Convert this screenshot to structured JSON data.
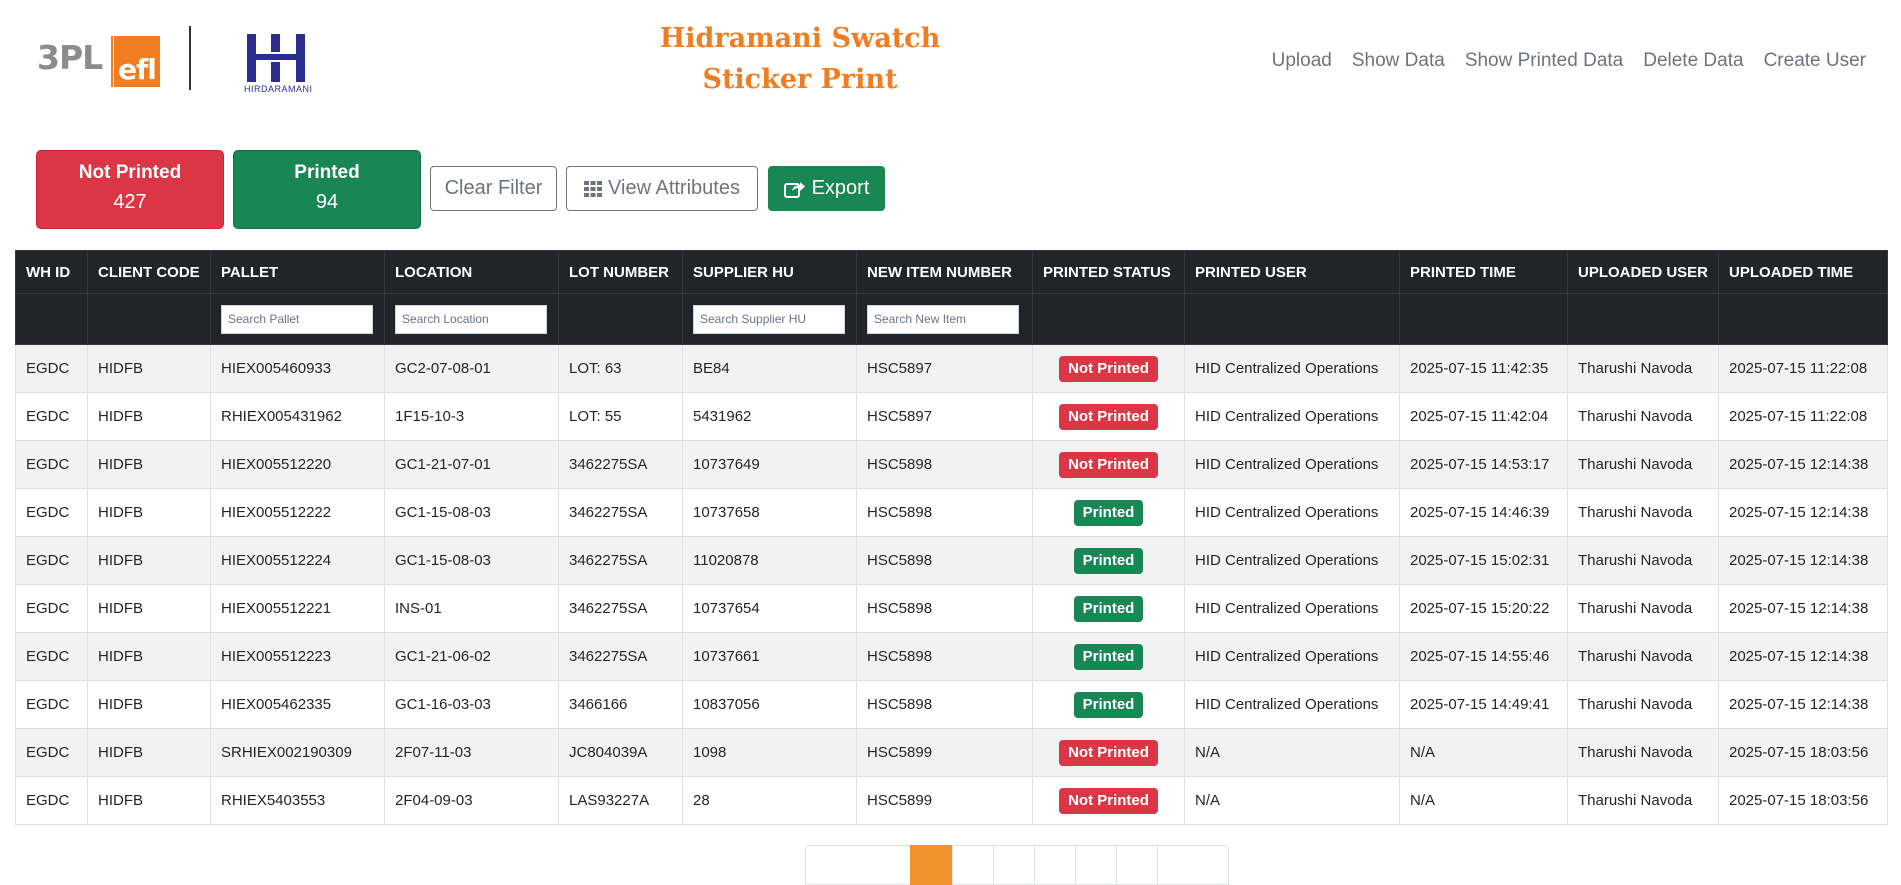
{
  "header": {
    "title_line1": "Hidramani Swatch",
    "title_line2": "Sticker Print",
    "logo_3pl": "3PL",
    "logo_efl": "efl",
    "logo_hid_text": "HIRDARAMANI",
    "nav": [
      {
        "label": "Upload"
      },
      {
        "label": "Show Data"
      },
      {
        "label": "Show Printed Data"
      },
      {
        "label": "Delete Data"
      },
      {
        "label": "Create User"
      }
    ]
  },
  "summary": {
    "not_printed_label": "Not Printed",
    "not_printed_count": "427",
    "printed_label": "Printed",
    "printed_count": "94"
  },
  "toolbar": {
    "clear_filter_label": "Clear Filter",
    "view_attributes_label": "View Attributes",
    "export_label": "Export"
  },
  "table": {
    "columns": [
      "WH ID",
      "CLIENT CODE",
      "PALLET",
      "LOCATION",
      "LOT NUMBER",
      "SUPPLIER HU",
      "NEW ITEM NUMBER",
      "PRINTED STATUS",
      "PRINTED USER",
      "PRINTED TIME",
      "UPLOADED USER",
      "UPLOADED TIME"
    ],
    "filters": {
      "pallet": "Search Pallet",
      "location": "Search Location",
      "supplier_hu": "Search Supplier HU",
      "new_item": "Search New Item"
    },
    "rows": [
      {
        "wh_id": "EGDC",
        "client_code": "HIDFB",
        "pallet": "HIEX005460933",
        "location": "GC2-07-08-01",
        "lot_number": "LOT: 63",
        "supplier_hu": "BE84",
        "new_item_number": "HSC5897",
        "printed_status": "Not Printed",
        "printed_user": "HID Centralized Operations",
        "printed_time": "2025-07-15 11:42:35",
        "uploaded_user": "Tharushi Navoda",
        "uploaded_time": "2025-07-15 11:22:08"
      },
      {
        "wh_id": "EGDC",
        "client_code": "HIDFB",
        "pallet": "RHIEX005431962",
        "location": "1F15-10-3",
        "lot_number": "LOT: 55",
        "supplier_hu": "5431962",
        "new_item_number": "HSC5897",
        "printed_status": "Not Printed",
        "printed_user": "HID Centralized Operations",
        "printed_time": "2025-07-15 11:42:04",
        "uploaded_user": "Tharushi Navoda",
        "uploaded_time": "2025-07-15 11:22:08"
      },
      {
        "wh_id": "EGDC",
        "client_code": "HIDFB",
        "pallet": "HIEX005512220",
        "location": "GC1-21-07-01",
        "lot_number": "3462275SA",
        "supplier_hu": "10737649",
        "new_item_number": "HSC5898",
        "printed_status": "Not Printed",
        "printed_user": "HID Centralized Operations",
        "printed_time": "2025-07-15 14:53:17",
        "uploaded_user": "Tharushi Navoda",
        "uploaded_time": "2025-07-15 12:14:38"
      },
      {
        "wh_id": "EGDC",
        "client_code": "HIDFB",
        "pallet": "HIEX005512222",
        "location": "GC1-15-08-03",
        "lot_number": "3462275SA",
        "supplier_hu": "10737658",
        "new_item_number": "HSC5898",
        "printed_status": "Printed",
        "printed_user": "HID Centralized Operations",
        "printed_time": "2025-07-15 14:46:39",
        "uploaded_user": "Tharushi Navoda",
        "uploaded_time": "2025-07-15 12:14:38"
      },
      {
        "wh_id": "EGDC",
        "client_code": "HIDFB",
        "pallet": "HIEX005512224",
        "location": "GC1-15-08-03",
        "lot_number": "3462275SA",
        "supplier_hu": "11020878",
        "new_item_number": "HSC5898",
        "printed_status": "Printed",
        "printed_user": "HID Centralized Operations",
        "printed_time": "2025-07-15 15:02:31",
        "uploaded_user": "Tharushi Navoda",
        "uploaded_time": "2025-07-15 12:14:38"
      },
      {
        "wh_id": "EGDC",
        "client_code": "HIDFB",
        "pallet": "HIEX005512221",
        "location": "INS-01",
        "lot_number": "3462275SA",
        "supplier_hu": "10737654",
        "new_item_number": "HSC5898",
        "printed_status": "Printed",
        "printed_user": "HID Centralized Operations",
        "printed_time": "2025-07-15 15:20:22",
        "uploaded_user": "Tharushi Navoda",
        "uploaded_time": "2025-07-15 12:14:38"
      },
      {
        "wh_id": "EGDC",
        "client_code": "HIDFB",
        "pallet": "HIEX005512223",
        "location": "GC1-21-06-02",
        "lot_number": "3462275SA",
        "supplier_hu": "10737661",
        "new_item_number": "HSC5898",
        "printed_status": "Printed",
        "printed_user": "HID Centralized Operations",
        "printed_time": "2025-07-15 14:55:46",
        "uploaded_user": "Tharushi Navoda",
        "uploaded_time": "2025-07-15 12:14:38"
      },
      {
        "wh_id": "EGDC",
        "client_code": "HIDFB",
        "pallet": "HIEX005462335",
        "location": "GC1-16-03-03",
        "lot_number": "3466166",
        "supplier_hu": "10837056",
        "new_item_number": "HSC5898",
        "printed_status": "Printed",
        "printed_user": "HID Centralized Operations",
        "printed_time": "2025-07-15 14:49:41",
        "uploaded_user": "Tharushi Navoda",
        "uploaded_time": "2025-07-15 12:14:38"
      },
      {
        "wh_id": "EGDC",
        "client_code": "HIDFB",
        "pallet": "SRHIEX002190309",
        "location": "2F07-11-03",
        "lot_number": "JC804039A",
        "supplier_hu": "1098",
        "new_item_number": "HSC5899",
        "printed_status": "Not Printed",
        "printed_user": "N/A",
        "printed_time": "N/A",
        "uploaded_user": "Tharushi Navoda",
        "uploaded_time": "2025-07-15 18:03:56"
      },
      {
        "wh_id": "EGDC",
        "client_code": "HIDFB",
        "pallet": "RHIEX5403553",
        "location": "2F04-09-03",
        "lot_number": "LAS93227A",
        "supplier_hu": "28",
        "new_item_number": "HSC5899",
        "printed_status": "Not Printed",
        "printed_user": "N/A",
        "printed_time": "N/A",
        "uploaded_user": "Tharushi Navoda",
        "uploaded_time": "2025-07-15 18:03:56"
      }
    ]
  },
  "colors": {
    "brand_orange": "#f07d22",
    "danger": "#dc3545",
    "success": "#198754",
    "table_header": "#212529"
  },
  "icons": {
    "view_attributes": "grid-icon",
    "export": "share-export-icon"
  }
}
